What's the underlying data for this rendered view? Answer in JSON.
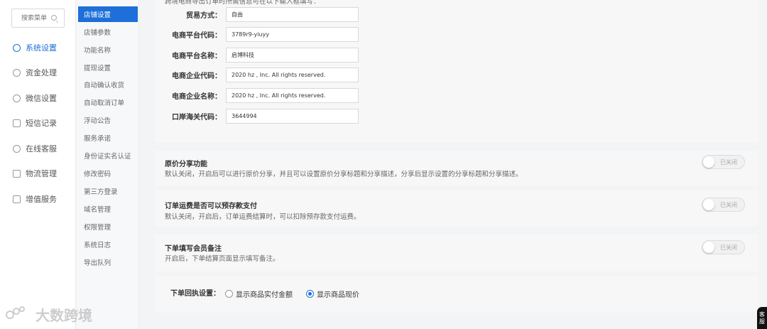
{
  "sidebar": {
    "search_placeholder": "搜索菜单",
    "items": [
      {
        "label": "系统设置",
        "icon": "gear-icon",
        "active": true
      },
      {
        "label": "资金处理",
        "icon": "coin-icon"
      },
      {
        "label": "微信设置",
        "icon": "wechat-icon"
      },
      {
        "label": "短信记录",
        "icon": "mail-icon"
      },
      {
        "label": "在线客服",
        "icon": "chat-icon"
      },
      {
        "label": "物流管理",
        "icon": "truck-icon"
      },
      {
        "label": "增值服务",
        "icon": "chart-icon"
      }
    ]
  },
  "submenu": {
    "items": [
      {
        "label": "店铺设置",
        "active": true
      },
      {
        "label": "店铺参数"
      },
      {
        "label": "功能名称"
      },
      {
        "label": "提现设置"
      },
      {
        "label": "自动确认收货"
      },
      {
        "label": "自动取消订单"
      },
      {
        "label": "浮动公告"
      },
      {
        "label": "服务承诺"
      },
      {
        "label": "身份证实名认证"
      },
      {
        "label": "修改密码"
      },
      {
        "label": "第三方登录"
      },
      {
        "label": "域名管理"
      },
      {
        "label": "权限管理"
      },
      {
        "label": "系统日志"
      },
      {
        "label": "导出队列"
      }
    ]
  },
  "cross_border": {
    "hint": "跨境电商导出订单时所需信息可在以下输入框填写：",
    "fields": [
      {
        "label": "贸易方式：",
        "value": "自由"
      },
      {
        "label": "电商平台代码：",
        "value": "3789r9-yiuyy"
      },
      {
        "label": "电商平台名称：",
        "value": "启博科技"
      },
      {
        "label": "电商企业代码：",
        "value": "2020 hz , Inc. All rights reserved."
      },
      {
        "label": "电商企业名称：",
        "value": "2020 hz , Inc. All rights reserved."
      },
      {
        "label": "口岸海关代码：",
        "value": "3644994"
      }
    ]
  },
  "features": [
    {
      "title": "原价分享功能",
      "desc": "默认关闭，开启后可以进行原价分享，并且可以设置原价分享标题和分享描述，分享后显示设置的分享标题和分享描述。",
      "toggle_label": "已关闭"
    },
    {
      "title": "订单运费是否可以预存款支付",
      "desc": "默认关闭，开启后，订单运费结算时，可以扣除预存款支付运费。",
      "toggle_label": "已关闭"
    },
    {
      "title": "下单填写会员备注",
      "desc": "开启后，下单结算页面显示填写备注。",
      "toggle_label": "已关闭"
    }
  ],
  "order_receipt": {
    "label": "下单回执设置：",
    "options": [
      {
        "label": "显示商品实付金额",
        "checked": false
      },
      {
        "label": "显示商品现价",
        "checked": true
      }
    ]
  },
  "watermark": {
    "text": "大数跨境"
  },
  "cs_tab": {
    "line1": "客",
    "line2": "服"
  },
  "colors": {
    "accent": "#1e6fd9"
  }
}
